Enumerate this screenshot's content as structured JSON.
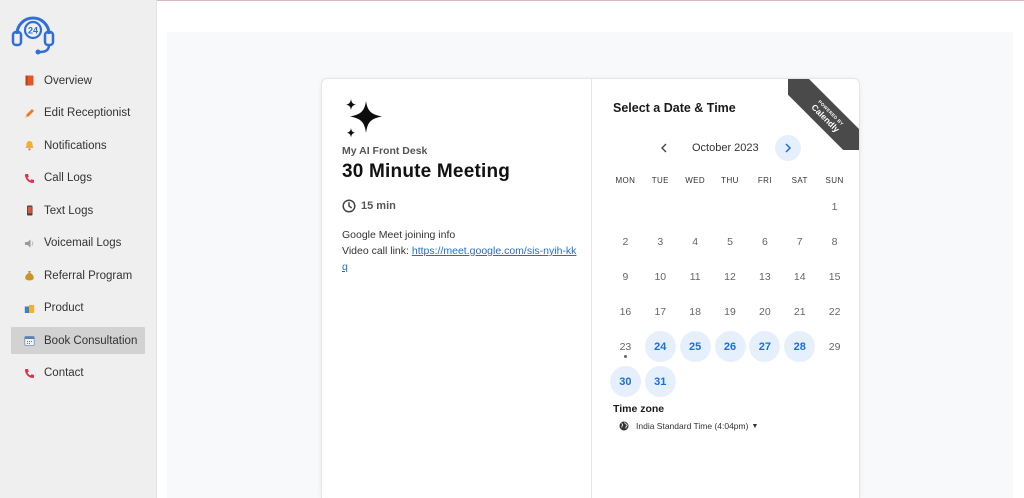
{
  "sidebar": {
    "items": [
      {
        "label": "Overview",
        "icon": "book-icon",
        "color": "#e0572a"
      },
      {
        "label": "Edit Receptionist",
        "icon": "pencil-icon",
        "color": "#e8782a"
      },
      {
        "label": "Notifications",
        "icon": "bell-icon",
        "color": "#f2b12b"
      },
      {
        "label": "Call Logs",
        "icon": "phone-icon",
        "color": "#e0314b"
      },
      {
        "label": "Text Logs",
        "icon": "mobile-icon",
        "color": "#444444"
      },
      {
        "label": "Voicemail Logs",
        "icon": "speaker-icon",
        "color": "#8a8a8a"
      },
      {
        "label": "Referral Program",
        "icon": "money-bag-icon",
        "color": "#c9952b"
      },
      {
        "label": "Product",
        "icon": "shopping-bags-icon",
        "color": "#3b82c4"
      },
      {
        "label": "Book Consultation",
        "icon": "calendar-icon",
        "color": "#5a7fb5",
        "active": true
      },
      {
        "label": "Contact",
        "icon": "phone-icon",
        "color": "#e0314b"
      }
    ]
  },
  "event": {
    "organizer": "My AI Front Desk",
    "title": "30 Minute Meeting",
    "duration": "15 min",
    "desc_line1": "Google Meet joining info",
    "desc_prefix": "Video call link: ",
    "link_text": "https://meet.google.com/sis-nyih-kkq"
  },
  "calendar": {
    "heading": "Select a Date & Time",
    "month": "October 2023",
    "weekdays": [
      "MON",
      "TUE",
      "WED",
      "THU",
      "FRI",
      "SAT",
      "SUN"
    ],
    "weeks": [
      [
        "",
        "",
        "",
        "",
        "",
        "",
        "1"
      ],
      [
        "2",
        "3",
        "4",
        "5",
        "6",
        "7",
        "8"
      ],
      [
        "9",
        "10",
        "11",
        "12",
        "13",
        "14",
        "15"
      ],
      [
        "16",
        "17",
        "18",
        "19",
        "20",
        "21",
        "22"
      ],
      [
        "23",
        "24",
        "25",
        "26",
        "27",
        "28",
        "29"
      ],
      [
        "30",
        "31",
        "",
        "",
        "",
        "",
        ""
      ]
    ],
    "available": [
      "24",
      "25",
      "26",
      "27",
      "28",
      "30",
      "31"
    ],
    "today": "23",
    "accent": "#1a6fd8",
    "available_bg": "#e6f0fd"
  },
  "timezone": {
    "label": "Time zone",
    "value": "India Standard Time (4:04pm)"
  },
  "badge": {
    "small": "POWERED BY",
    "big": "Calendly"
  }
}
